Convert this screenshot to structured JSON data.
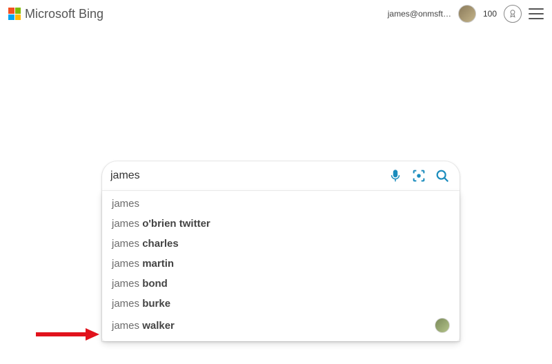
{
  "header": {
    "logo_text": "Microsoft Bing",
    "user_email": "james@onmsft…",
    "points": "100"
  },
  "search": {
    "value": "james"
  },
  "suggestions": [
    {
      "prefix": "james",
      "completion": "",
      "has_avatar": false
    },
    {
      "prefix": "james ",
      "completion": "o'brien twitter",
      "has_avatar": false
    },
    {
      "prefix": "james ",
      "completion": "charles",
      "has_avatar": false
    },
    {
      "prefix": "james ",
      "completion": "martin",
      "has_avatar": false
    },
    {
      "prefix": "james ",
      "completion": "bond",
      "has_avatar": false
    },
    {
      "prefix": "james ",
      "completion": "burke",
      "has_avatar": false
    },
    {
      "prefix": "james ",
      "completion": "walker",
      "has_avatar": true
    }
  ]
}
